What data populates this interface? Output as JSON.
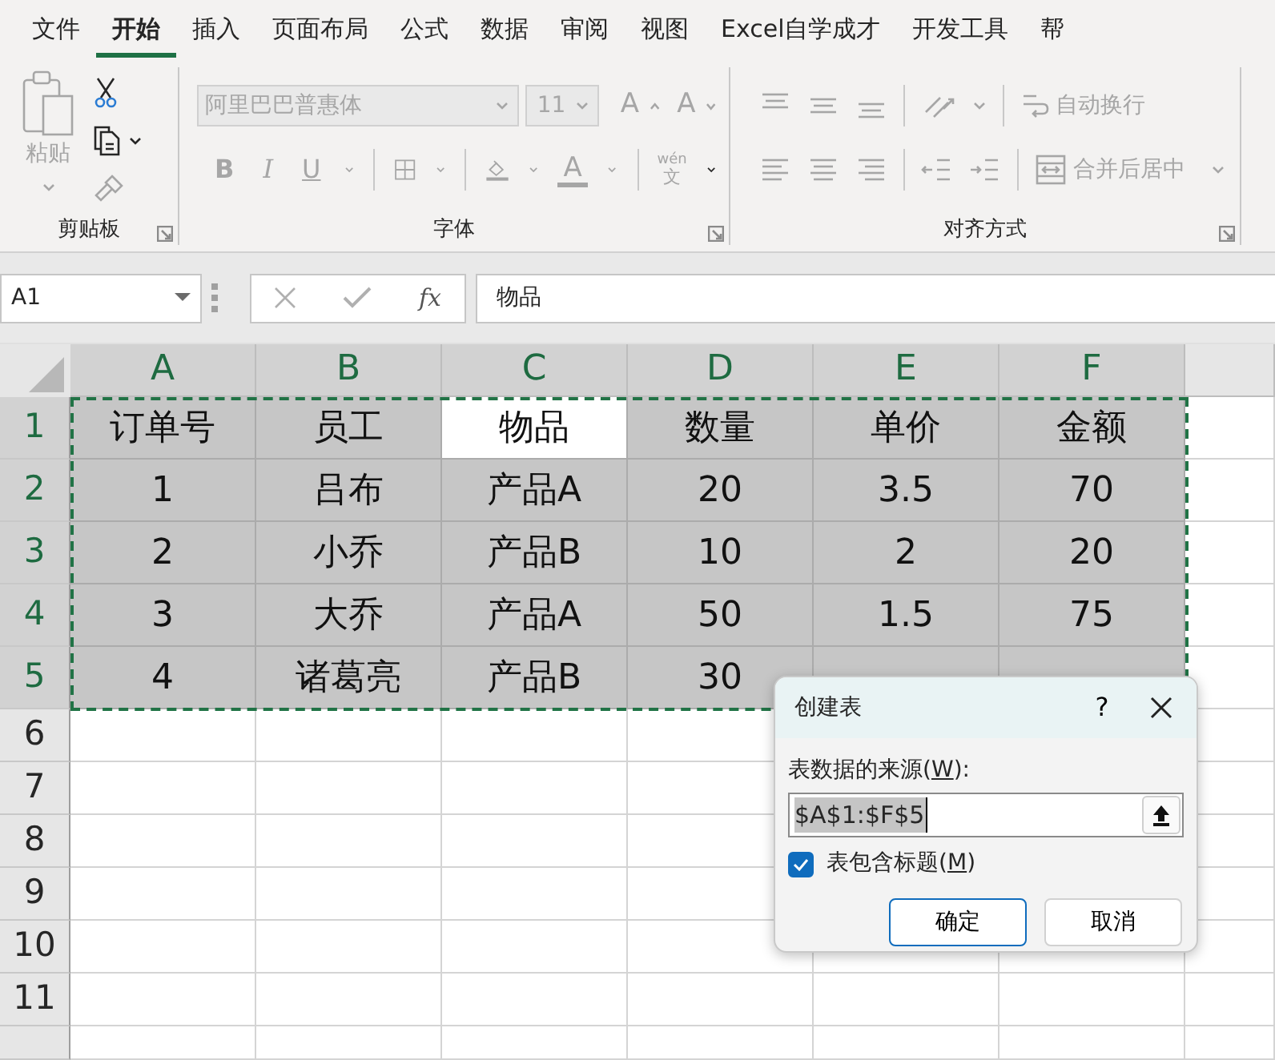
{
  "menu_tabs": [
    {
      "label": "文件",
      "selected": false
    },
    {
      "label": "开始",
      "selected": true
    },
    {
      "label": "插入",
      "selected": false
    },
    {
      "label": "页面布局",
      "selected": false
    },
    {
      "label": "公式",
      "selected": false
    },
    {
      "label": "数据",
      "selected": false
    },
    {
      "label": "审阅",
      "selected": false
    },
    {
      "label": "视图",
      "selected": false
    },
    {
      "label": "Excel自学成才",
      "selected": false
    },
    {
      "label": "开发工具",
      "selected": false
    },
    {
      "label": "帮",
      "selected": false
    }
  ],
  "clipboard": {
    "label": "剪贴板",
    "paste": {
      "label": "粘贴",
      "disabled": true
    },
    "cut": {
      "disabled": false
    },
    "copy": {
      "disabled": false
    },
    "format_painter": {
      "disabled": true
    }
  },
  "font": {
    "label": "字体",
    "disabled": true,
    "font_name": "阿里巴巴普惠体",
    "font_size": "11",
    "grow": "A",
    "shrink": "A",
    "bold": "B",
    "italic": "I",
    "underline": "U",
    "font_color": "A",
    "phonetic_top": "wén",
    "phonetic_bottom": "文"
  },
  "alignment": {
    "label": "对齐方式",
    "disabled": true,
    "wrap_text": "自动换行",
    "merge_center": "合并后居中"
  },
  "formula_bar": {
    "name_box": "A1",
    "function_button": "fx",
    "formula": "物品"
  },
  "sheet": {
    "copy_border": true,
    "columns": [
      {
        "label": "A",
        "highlighted": true
      },
      {
        "label": "B",
        "highlighted": true
      },
      {
        "label": "C",
        "highlighted": true
      },
      {
        "label": "D",
        "highlighted": true
      },
      {
        "label": "E",
        "highlighted": true
      },
      {
        "label": "F",
        "highlighted": true
      }
    ],
    "rows": [
      {
        "label": "1",
        "highlighted": true,
        "cells": [
          {
            "text": "订单号",
            "selected": true,
            "active": false
          },
          {
            "text": "员工",
            "selected": true,
            "active": false
          },
          {
            "text": "物品",
            "selected": true,
            "active": true
          },
          {
            "text": "数量",
            "selected": true,
            "active": false
          },
          {
            "text": "单价",
            "selected": true,
            "active": false
          },
          {
            "text": "金额",
            "selected": true,
            "active": false
          }
        ]
      },
      {
        "label": "2",
        "highlighted": true,
        "cells": [
          {
            "text": "1",
            "selected": true,
            "active": false
          },
          {
            "text": "吕布",
            "selected": true,
            "active": false
          },
          {
            "text": "产品A",
            "selected": true,
            "active": false
          },
          {
            "text": "20",
            "selected": true,
            "active": false
          },
          {
            "text": "3.5",
            "selected": true,
            "active": false
          },
          {
            "text": "70",
            "selected": true,
            "active": false
          }
        ]
      },
      {
        "label": "3",
        "highlighted": true,
        "cells": [
          {
            "text": "2",
            "selected": true,
            "active": false
          },
          {
            "text": "小乔",
            "selected": true,
            "active": false
          },
          {
            "text": "产品B",
            "selected": true,
            "active": false
          },
          {
            "text": "10",
            "selected": true,
            "active": false
          },
          {
            "text": "2",
            "selected": true,
            "active": false
          },
          {
            "text": "20",
            "selected": true,
            "active": false
          }
        ]
      },
      {
        "label": "4",
        "highlighted": true,
        "cells": [
          {
            "text": "3",
            "selected": true,
            "active": false
          },
          {
            "text": "大乔",
            "selected": true,
            "active": false
          },
          {
            "text": "产品A",
            "selected": true,
            "active": false
          },
          {
            "text": "50",
            "selected": true,
            "active": false
          },
          {
            "text": "1.5",
            "selected": true,
            "active": false
          },
          {
            "text": "75",
            "selected": true,
            "active": false
          }
        ]
      },
      {
        "label": "5",
        "highlighted": true,
        "cells": [
          {
            "text": "4",
            "selected": true,
            "active": false
          },
          {
            "text": "诸葛亮",
            "selected": true,
            "active": false
          },
          {
            "text": "产品B",
            "selected": true,
            "active": false
          },
          {
            "text": "30",
            "selected": true,
            "active": false
          }
        ]
      },
      {
        "label": "6",
        "highlighted": false,
        "cells": []
      },
      {
        "label": "7",
        "highlighted": false,
        "cells": []
      },
      {
        "label": "8",
        "highlighted": false,
        "cells": []
      },
      {
        "label": "9",
        "highlighted": false,
        "cells": []
      },
      {
        "label": "10",
        "highlighted": false,
        "cells": []
      },
      {
        "label": "11",
        "highlighted": false,
        "cells": []
      }
    ]
  },
  "dialog": {
    "title": "创建表",
    "help": "?",
    "source_label": {
      "before": "表数据的来源(",
      "key": "W",
      "after": "):"
    },
    "source_value": "$A$1:$F$5",
    "value_selected": true,
    "has_headers": {
      "before": "表包含标题(",
      "key": "M",
      "after": ")",
      "checked": true
    },
    "buttons": [
      {
        "label": "确定",
        "default": true
      },
      {
        "label": "取消",
        "default": false
      }
    ]
  }
}
